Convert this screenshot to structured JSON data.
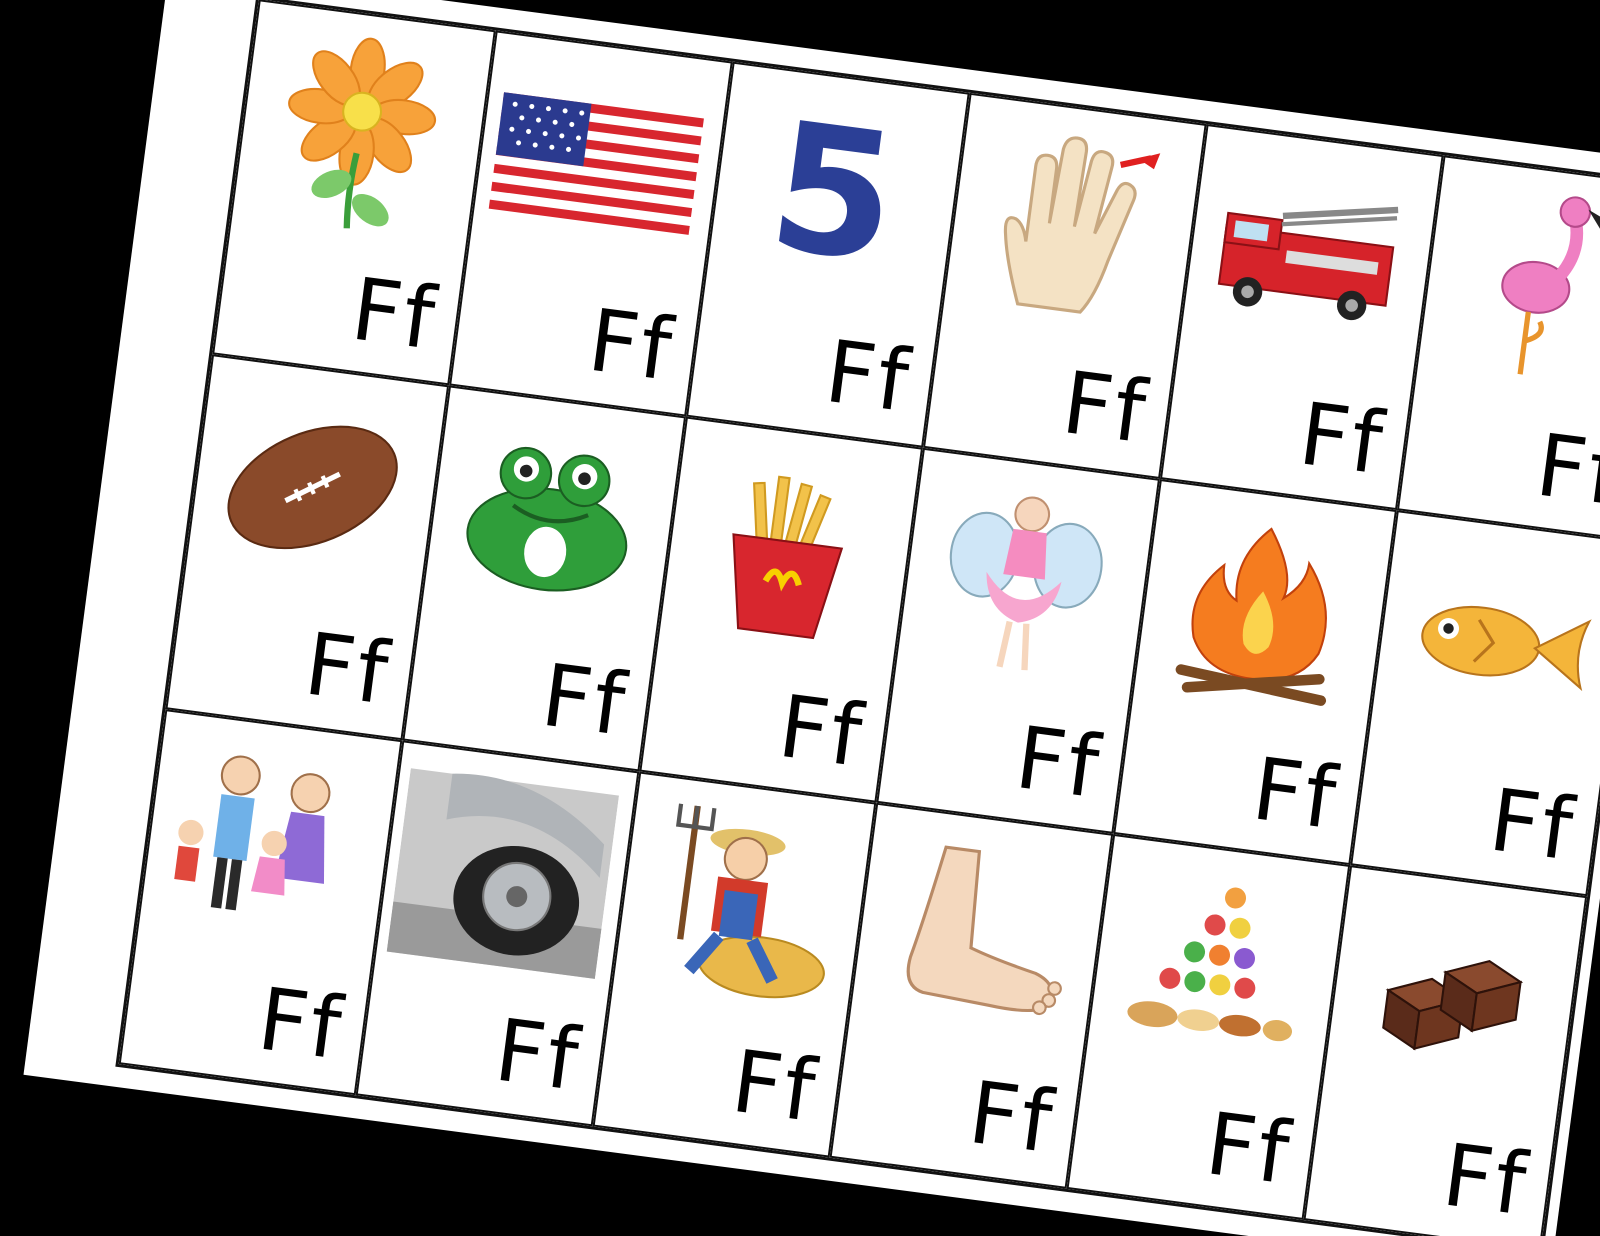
{
  "worksheet": {
    "cards": [
      {
        "label": "Ff",
        "icon": "flower-icon"
      },
      {
        "label": "Ff",
        "icon": "flag-icon"
      },
      {
        "label": "Ff",
        "icon": "number-five-icon"
      },
      {
        "label": "Ff",
        "icon": "finger-icon"
      },
      {
        "label": "Ff",
        "icon": "fire-truck-icon"
      },
      {
        "label": "Ff",
        "icon": "flamingo-icon"
      },
      {
        "label": "Ff",
        "icon": "football-icon"
      },
      {
        "label": "Ff",
        "icon": "frog-icon"
      },
      {
        "label": "Ff",
        "icon": "fries-icon"
      },
      {
        "label": "Ff",
        "icon": "fairy-icon"
      },
      {
        "label": "Ff",
        "icon": "fire-icon"
      },
      {
        "label": "Ff",
        "icon": "fish-icon"
      },
      {
        "label": "Ff",
        "icon": "family-icon"
      },
      {
        "label": "Ff",
        "icon": "flat-tire-icon"
      },
      {
        "label": "Ff",
        "icon": "farmer-icon"
      },
      {
        "label": "Ff",
        "icon": "foot-icon"
      },
      {
        "label": "Ff",
        "icon": "food-pyramid-icon"
      },
      {
        "label": "Ff",
        "icon": "fudge-icon"
      }
    ],
    "number_glyph": "5",
    "colors": {
      "flower_petal": "#f7a23a",
      "flag_red": "#d8262e",
      "flag_blue": "#2b3a8f",
      "number_blue": "#2b3f96",
      "fire_truck_red": "#d6232a",
      "flamingo_pink": "#ef7fc2",
      "football_brown": "#8a4a2a",
      "frog_green": "#2f9e3a",
      "fries_yellow": "#f2c24a",
      "fire_orange": "#f57c1f",
      "fish_yellow": "#f4b53a",
      "fudge_brown": "#5a2b1a"
    }
  }
}
